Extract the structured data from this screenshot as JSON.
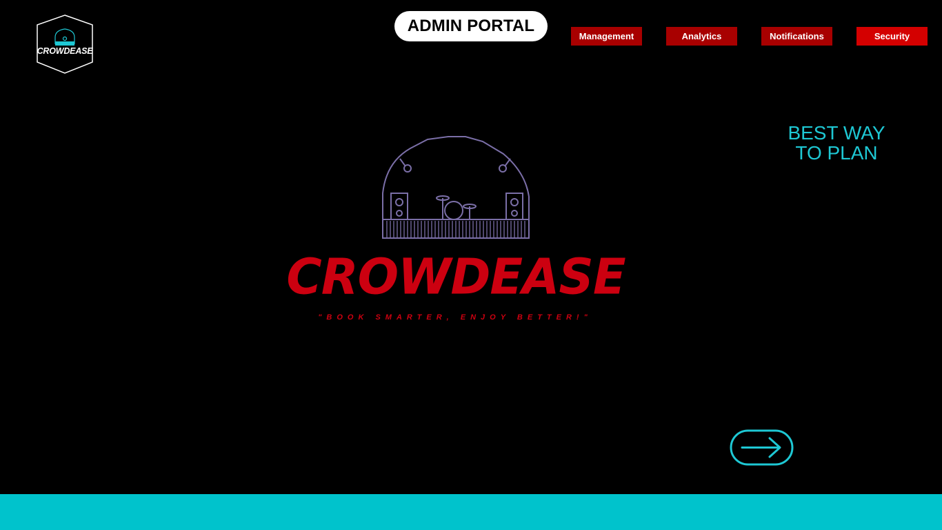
{
  "brand": {
    "badge_text": "CROWDEASE",
    "hero_title": "CROWDEASE",
    "slogan": "\"BOOK SMARTER, ENJOY BETTER!\"",
    "badge_icon": "concert-stage-icon"
  },
  "header": {
    "portal_label": "ADMIN PORTAL",
    "nav": [
      {
        "label": "Management"
      },
      {
        "label": "Analytics"
      },
      {
        "label": "Notifications"
      },
      {
        "label": "Security"
      }
    ]
  },
  "hero": {
    "tagline_line1": "BEST WAY",
    "tagline_line2": "TO PLAN",
    "illustration_icon": "concert-stage-icon",
    "next_icon": "arrow-right-icon"
  },
  "colors": {
    "background": "#000000",
    "accent_red": "#cc0010",
    "nav_red": "#a80000",
    "nav_active_red": "#d40000",
    "teal": "#1ec8d4",
    "footer": "#00c3cc",
    "stage_outline": "#7b6fa8"
  }
}
